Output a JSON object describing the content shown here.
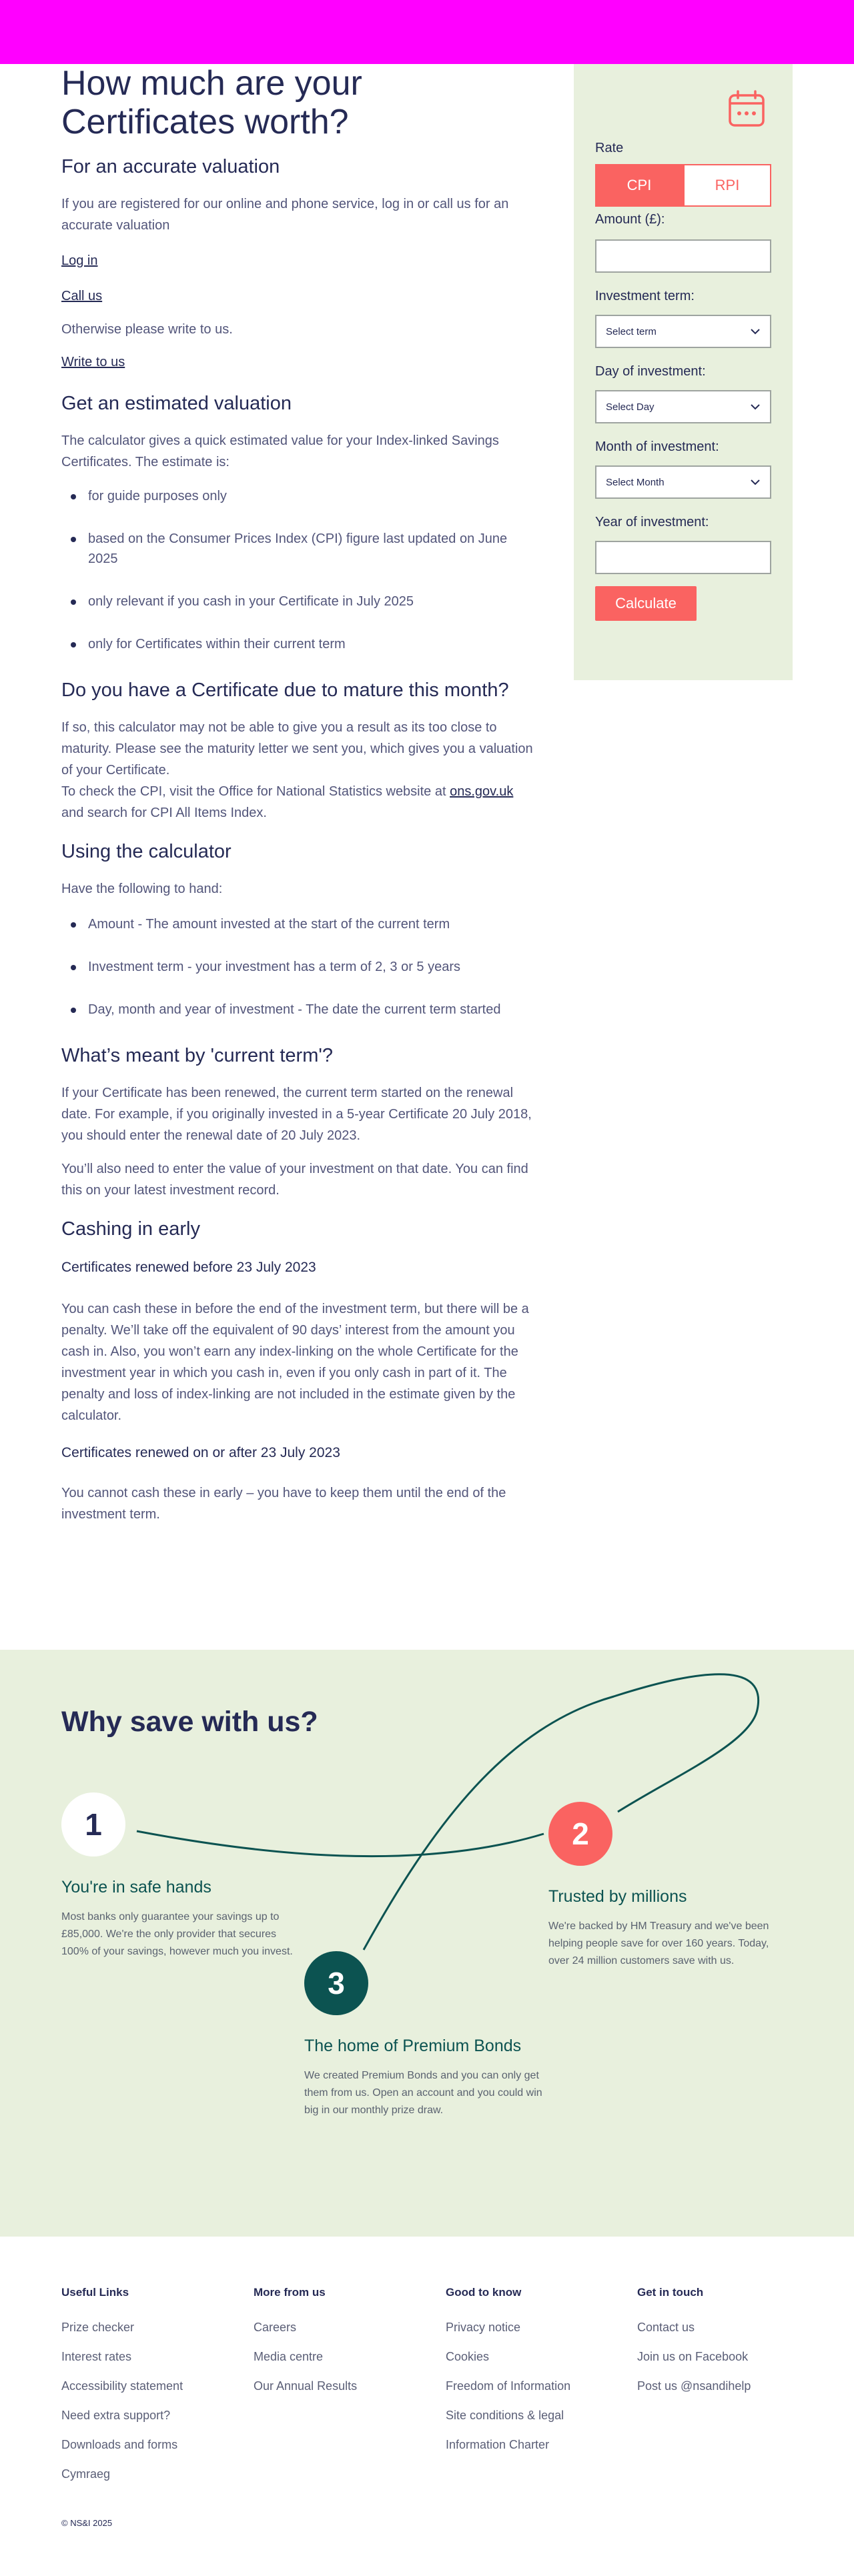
{
  "title": "How much are your Certificates worth?",
  "accurate": {
    "heading": "For an accurate valuation",
    "intro": "If you are registered for our online and phone service, log in or call us for an accurate valuation",
    "login": "Log in",
    "call": "Call us",
    "otherwise": "Otherwise please write to us.",
    "write": "Write to us"
  },
  "estimated": {
    "heading": "Get an estimated valuation",
    "intro": "The calculator gives a quick estimated value for your Index-linked Savings Certificates. The estimate is:",
    "bullets": [
      "for guide purposes only",
      "based on the Consumer Prices Index (CPI) figure last updated on June 2025",
      "only relevant if you cash in your Certificate in July 2025",
      "only for Certificates within their current term"
    ]
  },
  "mature": {
    "heading": "Do you have a Certificate due to mature this month?",
    "text": "If so, this calculator may not be able to give you a result as its too close to maturity. Please see the maturity letter we sent you, which gives you a valuation of your Certificate.",
    "cpi_before": "To check the CPI, visit the Office for National Statistics website at",
    "cpi_link": "ons.gov.uk",
    "cpi_after": "and search for CPI All Items Index."
  },
  "using": {
    "heading": "Using the calculator",
    "intro": "Have the following to hand:",
    "bullets": [
      "Amount - The amount invested at the start of the current term",
      "Investment term - your investment has a term of 2, 3 or 5 years",
      "Day, month and year of investment - The date the current term started"
    ]
  },
  "current": {
    "heading": "What’s meant by 'current term'?",
    "p1": "If your Certificate has been renewed, the current term started on the renewal date. For example, if you originally invested in a 5-year Certificate 20 July 2018, you should enter the renewal date of 20 July 2023.",
    "p2": "You’ll also need to enter the value of your investment on that date. You can find this on your latest investment record."
  },
  "cashing": {
    "heading": "Cashing in early",
    "sub1": "Certificates renewed before 23 July 2023",
    "p1": "You can cash these in before the end of the investment term, but there will be a penalty. We’ll take off the equivalent of 90 days’ interest from the amount you cash in. Also, you won’t earn any index-linking on the whole Certificate for the investment year in which you cash in, even if you only cash in part of it. The penalty and loss of index-linking are not included in the estimate given by the calculator.",
    "sub2": "Certificates renewed on or after 23 July 2023",
    "p2": "You cannot cash these in early – you have to keep them until the end of the investment term."
  },
  "calculator": {
    "icon": "calendar-icon",
    "rate_label": "Rate",
    "cpi": "CPI",
    "rpi": "RPI",
    "amount_label": "Amount (£):",
    "amount_value": "",
    "term_label": "Investment term:",
    "term_select": "Select term",
    "day_label": "Day of investment:",
    "day_select": "Select Day",
    "month_label": "Month of investment:",
    "month_select": "Select Month",
    "year_label": "Year of investment:",
    "year_value": "",
    "button": "Calculate"
  },
  "why": {
    "heading": "Why save with us?",
    "items": [
      {
        "num": "1",
        "title": "You're in safe hands",
        "text": "Most banks only guarantee your savings up to £85,000. We're the only provider that secures 100% of your savings, however much you invest."
      },
      {
        "num": "2",
        "title": "Trusted by millions",
        "text": "We're backed by HM Treasury and we've been helping people save for over 160 years. Today, over 24 million customers save with us."
      },
      {
        "num": "3",
        "title": "The home of Premium Bonds",
        "text": "We created Premium Bonds and you can only get them from us. Open an account and you could win big in our monthly prize draw."
      }
    ]
  },
  "footer": {
    "cols": [
      {
        "heading": "Useful Links",
        "links": [
          "Prize checker",
          "Interest rates",
          "Accessibility statement",
          "Need extra support?",
          "Downloads and forms",
          "Cymraeg"
        ]
      },
      {
        "heading": "More from us",
        "links": [
          "Careers",
          "Media centre",
          "Our Annual Results"
        ]
      },
      {
        "heading": "Good to know",
        "links": [
          "Privacy notice",
          "Cookies",
          "Freedom of Information",
          "Site conditions & legal",
          "Information Charter"
        ]
      },
      {
        "heading": "Get in touch",
        "links": [
          "Contact us",
          "Join us on Facebook",
          "Post us @nsandihelp"
        ]
      }
    ],
    "copyright": "© NS&I 2025"
  },
  "colors": {
    "brand_navy": "#252a55",
    "accent_coral": "#fa6361",
    "panel_green": "#e8f0dd",
    "teal": "#0c5351",
    "top_bar": "#ff00ff"
  }
}
